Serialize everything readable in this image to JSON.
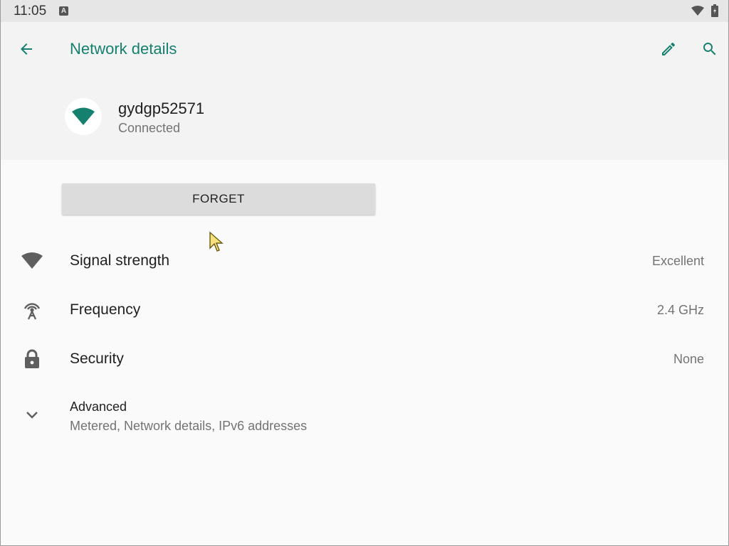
{
  "status_bar": {
    "time": "11:05",
    "notification_icon_letter": "A",
    "icons": [
      "notification-a-icon",
      "wifi-signal-icon",
      "battery-icon"
    ]
  },
  "header": {
    "title": "Network details",
    "back_icon": "arrow-left-icon",
    "edit_icon": "pencil-icon",
    "search_icon": "search-icon"
  },
  "network": {
    "name": "gydgp52571",
    "status": "Connected",
    "icon": "wifi-icon"
  },
  "actions": {
    "forget_label": "FORGET"
  },
  "details": [
    {
      "icon": "wifi-signal-icon",
      "label": "Signal strength",
      "value": "Excellent"
    },
    {
      "icon": "frequency-antenna-icon",
      "label": "Frequency",
      "value": "2.4 GHz"
    },
    {
      "icon": "lock-icon",
      "label": "Security",
      "value": "None"
    }
  ],
  "advanced": {
    "icon": "chevron-down-icon",
    "label": "Advanced",
    "summary": "Metered, Network details, IPv6 addresses"
  },
  "colors": {
    "accent": "#16806e",
    "background": "#fafafa",
    "header_background": "#f3f3f3",
    "status_bar": "#e6e6e6",
    "button": "#dcdcdc",
    "secondary_text": "#737373"
  }
}
